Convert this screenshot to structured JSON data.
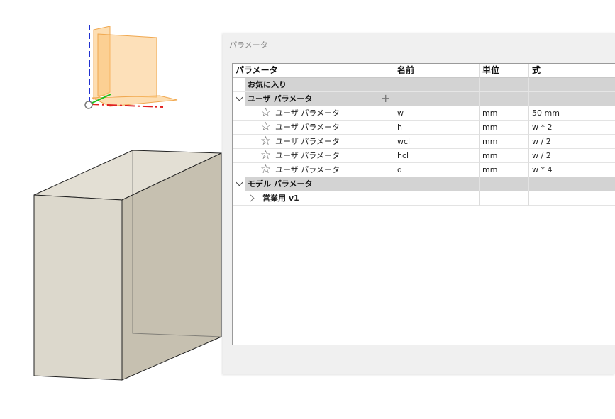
{
  "panel": {
    "title": "パラメータ"
  },
  "table": {
    "headers": {
      "parameter": "パラメータ",
      "name": "名前",
      "unit": "単位",
      "expression": "式"
    },
    "favorites_label": "お気に入り",
    "user_group_label": "ユーザ パラメータ",
    "add_symbol": "+",
    "star_symbol": "☆",
    "user_params": [
      {
        "label": "ユーザ パラメータ",
        "name": "w",
        "unit": "mm",
        "expression": "50 mm"
      },
      {
        "label": "ユーザ パラメータ",
        "name": "h",
        "unit": "mm",
        "expression": "w * 2"
      },
      {
        "label": "ユーザ パラメータ",
        "name": "wcl",
        "unit": "mm",
        "expression": "w / 2"
      },
      {
        "label": "ユーザ パラメータ",
        "name": "hcl",
        "unit": "mm",
        "expression": "w / 2"
      },
      {
        "label": "ユーザ パラメータ",
        "name": "d",
        "unit": "mm",
        "expression": "w * 4"
      }
    ],
    "model_group_label": "モデル パラメータ",
    "model_component_label": "営業用 v1"
  },
  "colors": {
    "box_front": "#dcd8cc",
    "box_side": "#c6c0b0",
    "box_top": "#e3dfd4",
    "plane_orange": "#fbc273",
    "axis_x": "#e02020",
    "axis_y": "#20c020",
    "axis_z": "#2030d0"
  }
}
